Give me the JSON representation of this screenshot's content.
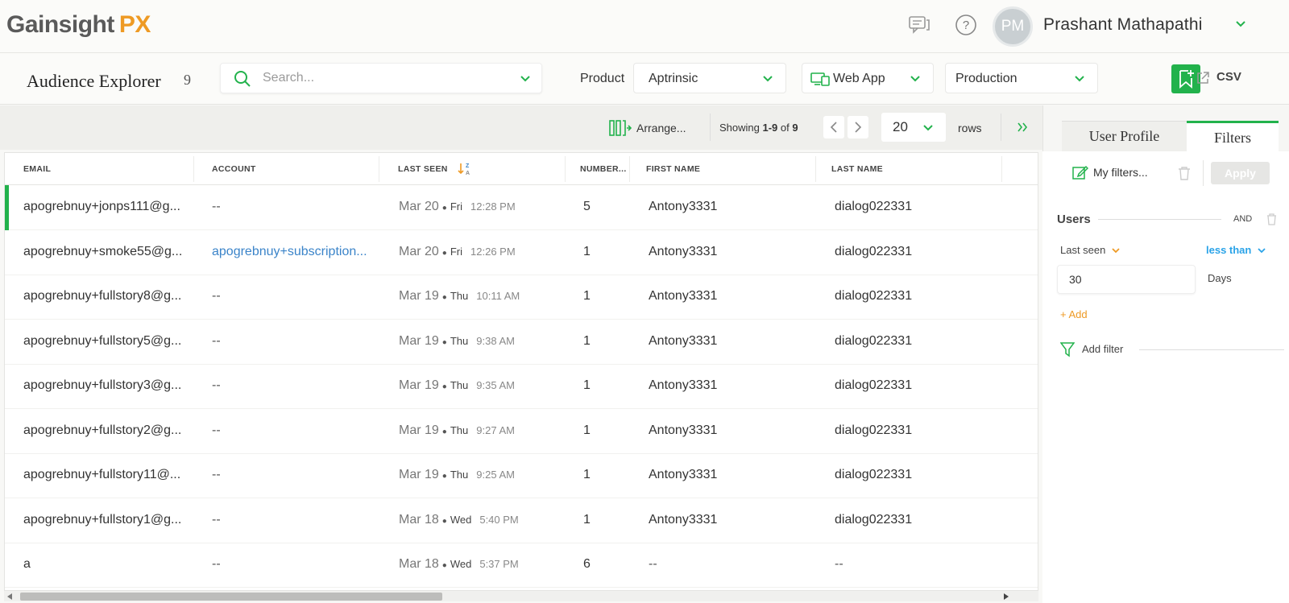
{
  "header": {
    "logo_text": "Gainsight",
    "logo_suffix": "PX",
    "user_name": "Prashant Mathapathi",
    "avatar_initials": "PM"
  },
  "subheader": {
    "title": "Audience Explorer",
    "count": "9",
    "search_placeholder": "Search...",
    "product_label": "Product",
    "product_value": "Aptrinsic",
    "app_value": "Web App",
    "env_value": "Production",
    "csv_label": "CSV"
  },
  "toolbar": {
    "arrange_label": "Arrange...",
    "showing_prefix": "Showing",
    "showing_range": "1-9",
    "showing_of": "of",
    "showing_total": "9",
    "rows_value": "20",
    "rows_label": "rows"
  },
  "table": {
    "columns": [
      "EMAIL",
      "ACCOUNT",
      "LAST SEEN",
      "NUMBER...",
      "FIRST NAME",
      "LAST NAME"
    ],
    "rows": [
      {
        "email": "apogrebnuy+jonps111@g...",
        "account": "--",
        "date": "Mar 20",
        "day": "Fri",
        "time": "12:28 PM",
        "number": "5",
        "first": "Antony3331",
        "last": "dialog022331"
      },
      {
        "email": "apogrebnuy+smoke55@g...",
        "account": "apogrebnuy+subscription...",
        "date": "Mar 20",
        "day": "Fri",
        "time": "12:26 PM",
        "number": "1",
        "first": "Antony3331",
        "last": "dialog022331"
      },
      {
        "email": "apogrebnuy+fullstory8@g...",
        "account": "--",
        "date": "Mar 19",
        "day": "Thu",
        "time": "10:11 AM",
        "number": "1",
        "first": "Antony3331",
        "last": "dialog022331"
      },
      {
        "email": "apogrebnuy+fullstory5@g...",
        "account": "--",
        "date": "Mar 19",
        "day": "Thu",
        "time": "9:38 AM",
        "number": "1",
        "first": "Antony3331",
        "last": "dialog022331"
      },
      {
        "email": "apogrebnuy+fullstory3@g...",
        "account": "--",
        "date": "Mar 19",
        "day": "Thu",
        "time": "9:35 AM",
        "number": "1",
        "first": "Antony3331",
        "last": "dialog022331"
      },
      {
        "email": "apogrebnuy+fullstory2@g...",
        "account": "--",
        "date": "Mar 19",
        "day": "Thu",
        "time": "9:27 AM",
        "number": "1",
        "first": "Antony3331",
        "last": "dialog022331"
      },
      {
        "email": "apogrebnuy+fullstory11@...",
        "account": "--",
        "date": "Mar 19",
        "day": "Thu",
        "time": "9:25 AM",
        "number": "1",
        "first": "Antony3331",
        "last": "dialog022331"
      },
      {
        "email": "apogrebnuy+fullstory1@g...",
        "account": "--",
        "date": "Mar 18",
        "day": "Wed",
        "time": "5:40 PM",
        "number": "1",
        "first": "Antony3331",
        "last": "dialog022331"
      },
      {
        "email": "a",
        "account": "--",
        "date": "Mar 18",
        "day": "Wed",
        "time": "5:37 PM",
        "number": "6",
        "first": "--",
        "last": "--"
      }
    ]
  },
  "panel": {
    "tab_profile": "User Profile",
    "tab_filters": "Filters",
    "my_filters": "My filters...",
    "apply": "Apply",
    "section": "Users",
    "logic": "AND",
    "field": "Last seen",
    "operator": "less than",
    "value": "30",
    "unit": "Days",
    "add": "+ Add",
    "add_filter": "Add filter"
  },
  "colors": {
    "accent_green": "#22b24c",
    "orange": "#ee9a24",
    "link_blue": "#3b84c9",
    "operator_blue": "#2aa3e8"
  },
  "icons": [
    "chat-icon",
    "help-icon",
    "search-icon",
    "chevron-down-icon",
    "monitor-icon",
    "bookmark-add-icon",
    "external-link-icon",
    "columns-icon",
    "chevron-left-icon",
    "chevron-right-icon",
    "double-chevron-right-icon",
    "sort-icon",
    "edit-icon",
    "trash-icon",
    "filter-icon"
  ]
}
